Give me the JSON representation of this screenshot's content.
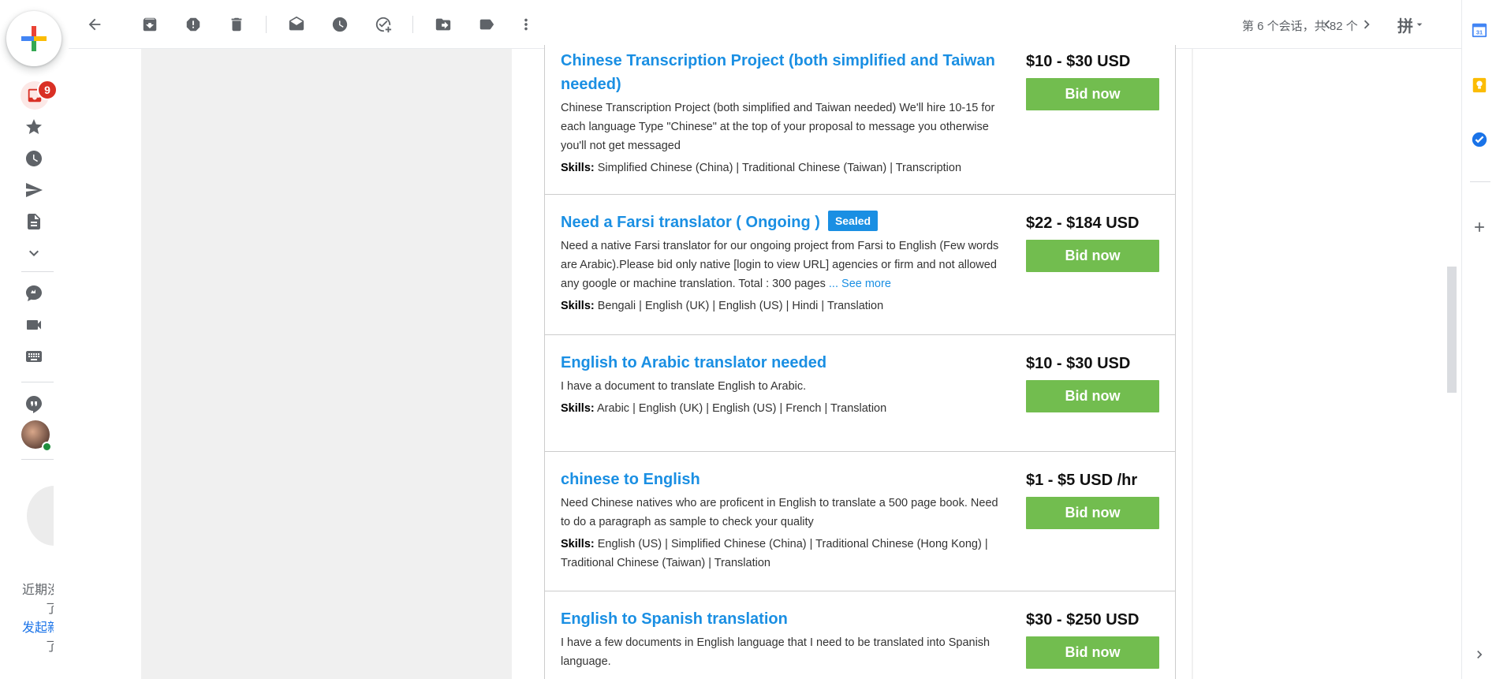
{
  "rail": {
    "inbox_badge": "9",
    "snippet_line1": "近期没",
    "snippet_line2": "了",
    "snippet_link": "发起新",
    "snippet_line4": "了"
  },
  "toolbar": {
    "pager": "第 6 个会话，共 82 个",
    "input_tool_glyph": "拼"
  },
  "jobs": [
    {
      "title": "Chinese Transcription Project (both simplified and Taiwan needed)",
      "sealed": "",
      "description": "Chinese Transcription Project (both simplified and Taiwan needed) We'll hire 10-15 for each language Type \"Chinese\" at the top of your proposal to message you otherwise you'll not get messaged",
      "see_more": "",
      "skills_label": "Skills:",
      "skills": "Simplified Chinese (China) | Traditional Chinese (Taiwan) | Transcription",
      "price": "$10 - $30 USD",
      "bid_label": "Bid now"
    },
    {
      "title": "Need a Farsi translator ( Ongoing )",
      "sealed": "Sealed",
      "description": "Need a native Farsi translator for our ongoing project from Farsi to English (Few words are Arabic).Please bid only native [login to view URL] agencies or firm and not allowed any google or machine translation. Total : 300 pages",
      "see_more": "... See more",
      "skills_label": "Skills:",
      "skills": "Bengali | English (UK) | English (US) | Hindi | Translation",
      "price": "$22 - $184 USD",
      "bid_label": "Bid now"
    },
    {
      "title": "English to Arabic translator needed",
      "sealed": "",
      "description": "I have a document to translate English to Arabic.",
      "see_more": "",
      "skills_label": "Skills:",
      "skills": "Arabic | English (UK) | English (US) | French | Translation",
      "price": "$10 - $30 USD",
      "bid_label": "Bid now"
    },
    {
      "title": "chinese to English",
      "sealed": "",
      "description": "Need Chinese natives who are proficent in English to translate a 500 page book. Need to do a paragraph as sample to check your quality",
      "see_more": "",
      "skills_label": "Skills:",
      "skills": "English (US) | Simplified Chinese (China) | Traditional Chinese (Hong Kong) | Traditional Chinese (Taiwan) | Translation",
      "price": "$1 - $5 USD /hr",
      "bid_label": "Bid now"
    },
    {
      "title": "English to Spanish translation",
      "sealed": "",
      "description": "I have a few documents in English language that I need to be translated into Spanish language.",
      "see_more": "",
      "skills_label": "",
      "skills": "",
      "price": "$30 - $250 USD",
      "bid_label": "Bid now"
    }
  ],
  "side_panel": {
    "calendar_day": "31"
  },
  "colors": {
    "link_blue": "#1a8fe3",
    "bid_green": "#72bd4f",
    "badge_red": "#d93025"
  }
}
